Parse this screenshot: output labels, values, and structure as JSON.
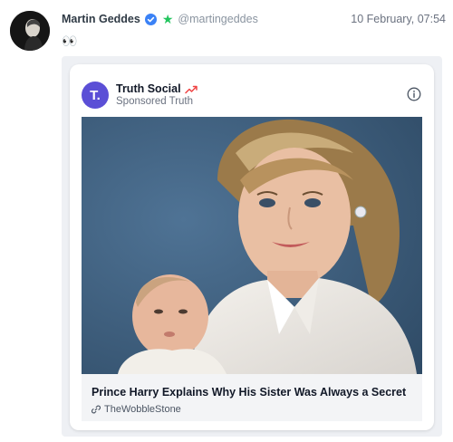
{
  "post": {
    "author_name": "Martin Geddes",
    "handle": "@martingeddes",
    "date": "10 February, 07:54",
    "text": "👀",
    "icons": {
      "avatar": "avatar",
      "verified": "verified-badge-icon",
      "star": "star-icon",
      "eyes": "eyes-icon"
    }
  },
  "ad": {
    "brand_logo_text": "T.",
    "brand_name": "Truth Social",
    "sponsored_label": "Sponsored Truth",
    "headline": "Prince Harry Explains Why His Sister Was Always a Secret",
    "source": "TheWobbleStone",
    "icons": {
      "trend": "trending-arrow-icon",
      "info": "info-icon",
      "link": "link-icon"
    }
  },
  "colors": {
    "brand_purple": "#5b4fd6",
    "verified_blue": "#3b82f6",
    "star_green": "#22c55e",
    "trend_red": "#ef4444"
  }
}
